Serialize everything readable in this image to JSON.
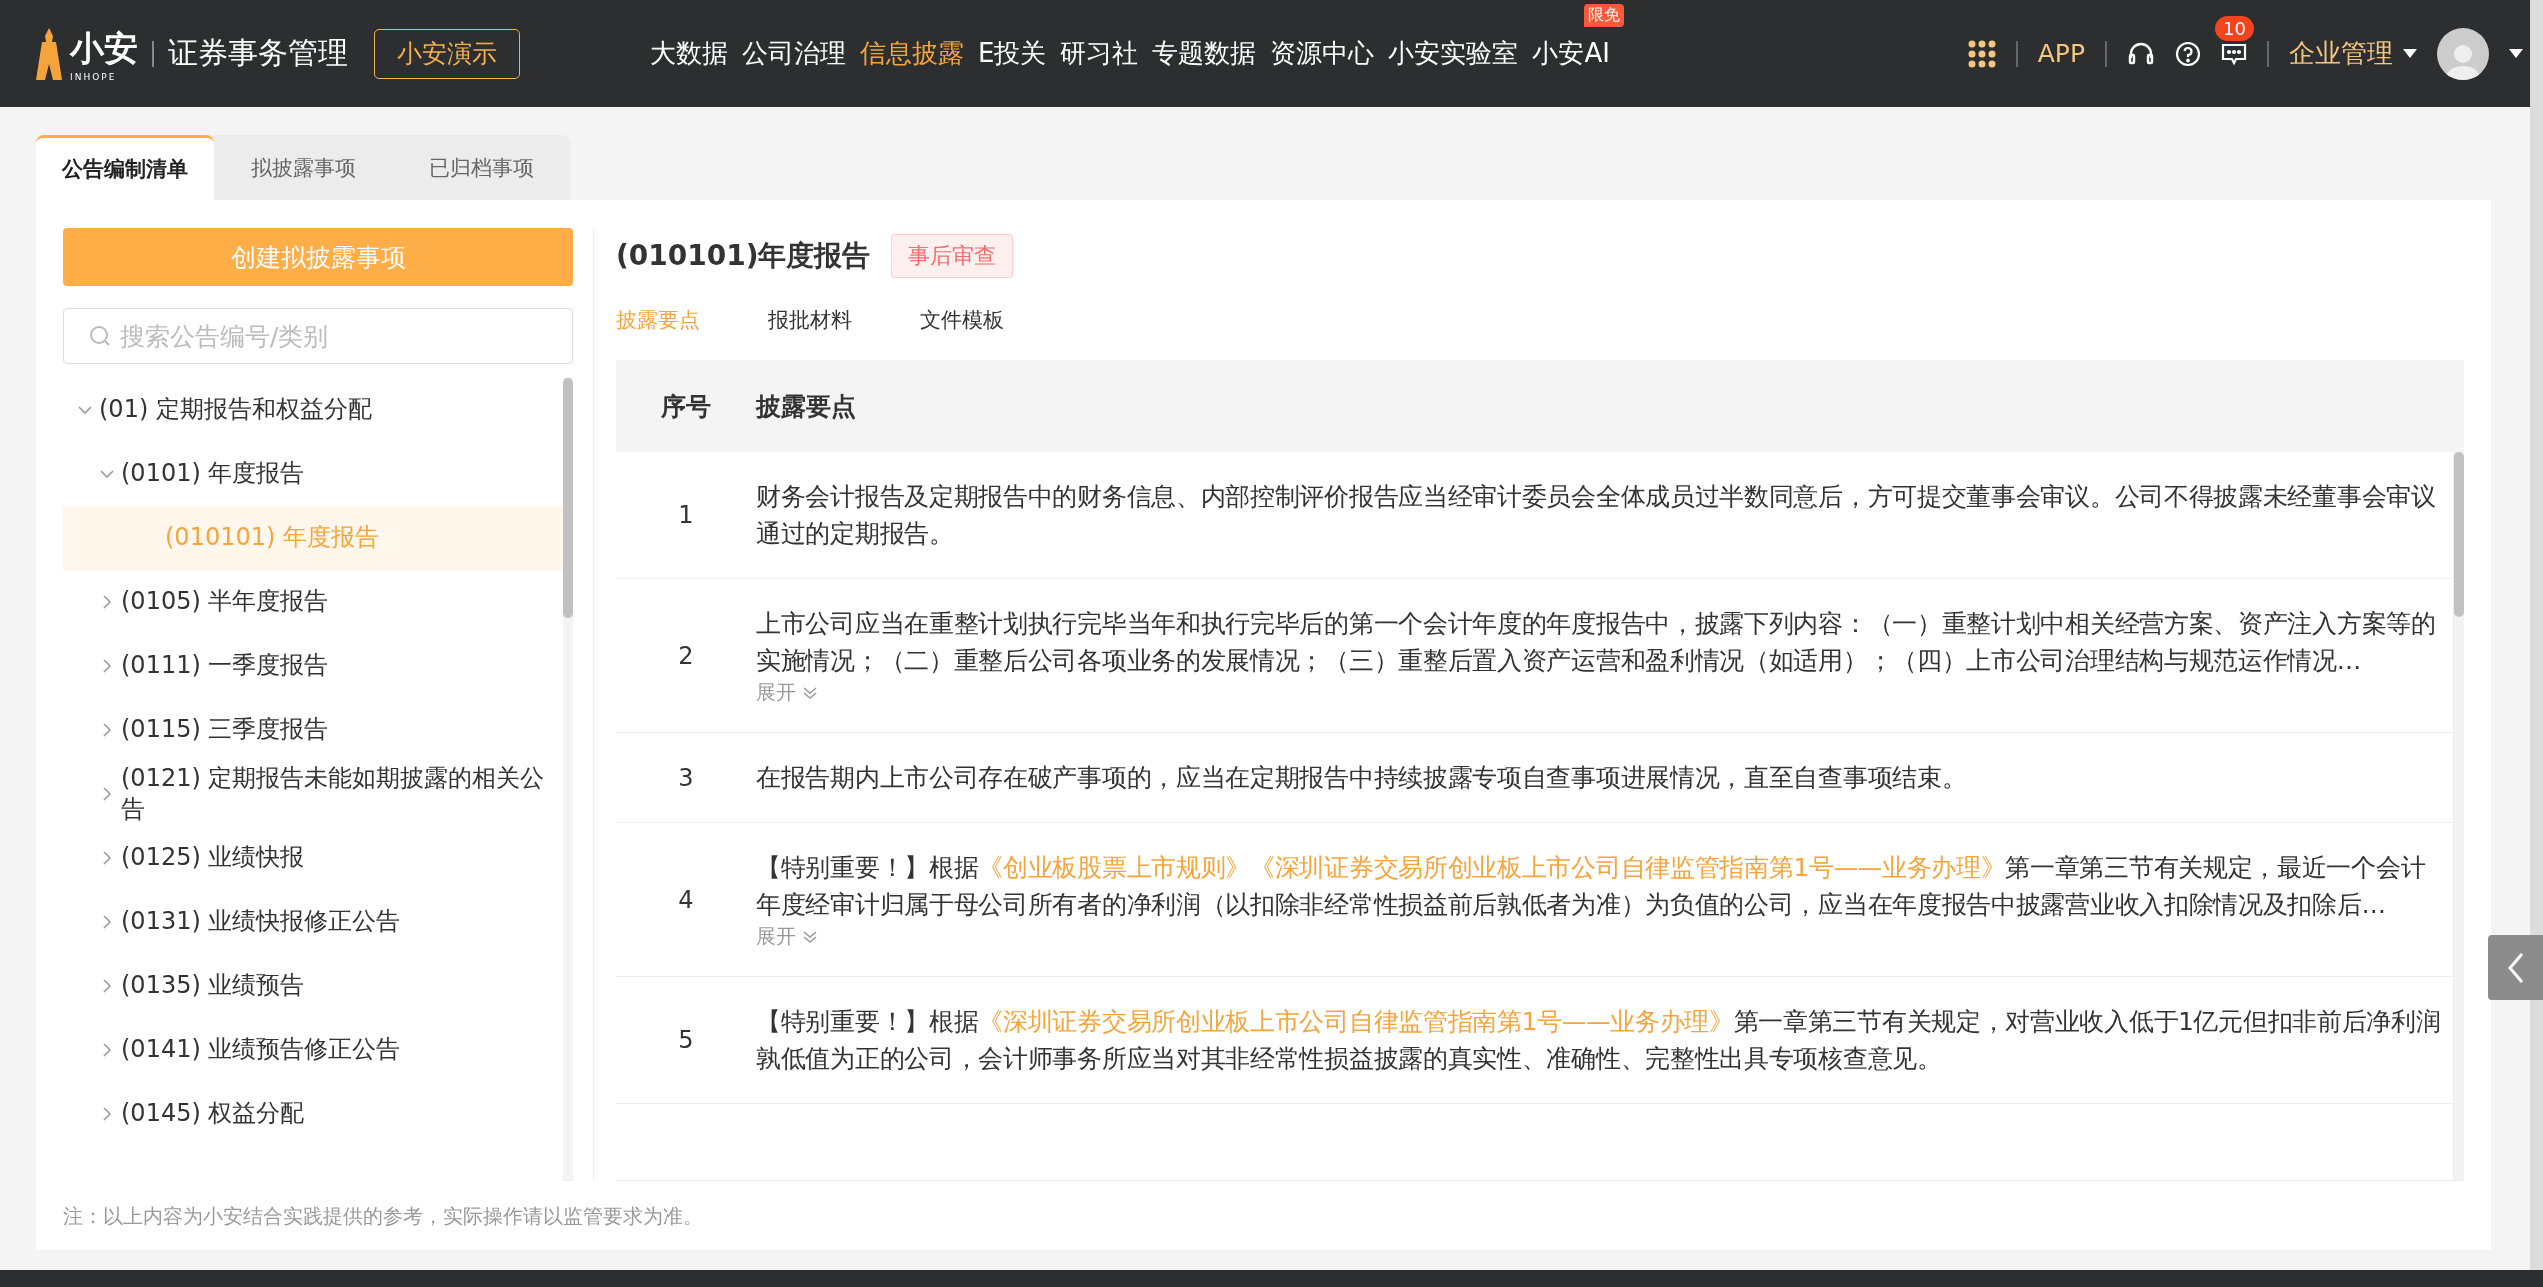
{
  "header": {
    "logo_text": "小安",
    "logo_sub": "INHOPE",
    "title": "证券事务管理",
    "demo_button": "小安演示",
    "nav": [
      {
        "label": "大数据",
        "selected": false
      },
      {
        "label": "公司治理",
        "selected": false
      },
      {
        "label": "信息披露",
        "selected": true
      },
      {
        "label": "E投关",
        "selected": false
      },
      {
        "label": "研习社",
        "selected": false
      },
      {
        "label": "专题数据",
        "selected": false
      },
      {
        "label": "资源中心",
        "selected": false
      },
      {
        "label": "小安实验室",
        "selected": false
      },
      {
        "label": "小安AI",
        "selected": false,
        "badge": "限免"
      }
    ],
    "app_link": "APP",
    "message_count": "10",
    "org_menu": "企业管理"
  },
  "tabs": [
    {
      "label": "公告编制清单",
      "selected": true
    },
    {
      "label": "拟披露事项",
      "selected": false
    },
    {
      "label": "已归档事项",
      "selected": false
    }
  ],
  "create_button": "创建拟披露事项",
  "search": {
    "placeholder": "搜索公告编号/类别"
  },
  "tree": [
    {
      "label": "(01) 定期报告和权益分配",
      "kind": "group",
      "expanded": true,
      "selected": false,
      "children": [
        {
          "label": "(0101) 年度报告",
          "kind": "group",
          "expanded": true,
          "selected": false,
          "children": [
            {
              "label": "(010101) 年度报告",
              "kind": "leaf",
              "expanded": false,
              "selected": true
            }
          ]
        },
        {
          "label": "(0105) 半年度报告",
          "kind": "group",
          "expanded": false,
          "selected": false
        },
        {
          "label": "(0111) 一季度报告",
          "kind": "group",
          "expanded": false,
          "selected": false
        },
        {
          "label": "(0115) 三季度报告",
          "kind": "group",
          "expanded": false,
          "selected": false
        },
        {
          "label": "(0121) 定期报告未能如期披露的相关公告",
          "kind": "group",
          "expanded": false,
          "selected": false
        },
        {
          "label": "(0125) 业绩快报",
          "kind": "group",
          "expanded": false,
          "selected": false
        },
        {
          "label": "(0131) 业绩快报修正公告",
          "kind": "group",
          "expanded": false,
          "selected": false
        },
        {
          "label": "(0135) 业绩预告",
          "kind": "group",
          "expanded": false,
          "selected": false
        },
        {
          "label": "(0141) 业绩预告修正公告",
          "kind": "group",
          "expanded": false,
          "selected": false
        },
        {
          "label": "(0145) 权益分配",
          "kind": "group",
          "expanded": false,
          "selected": false
        }
      ]
    }
  ],
  "detail": {
    "title": "(010101)年度报告",
    "tag": "事后审查",
    "subtabs": [
      {
        "label": "披露要点",
        "selected": true
      },
      {
        "label": "报批材料",
        "selected": false
      },
      {
        "label": "文件模板",
        "selected": false
      }
    ],
    "table": {
      "columns": [
        "序号",
        "披露要点"
      ],
      "rows": [
        {
          "number": "1",
          "parts": [
            {
              "kind": "text",
              "text": "财务会计报告及定期报告中的财务信息、内部控制评价报告应当经审计委员会全体成员过半数同意后，方可提交董事会审议。公司不得披露未经董事会审议通过的定期报告。"
            }
          ]
        },
        {
          "number": "2",
          "parts": [
            {
              "kind": "text",
              "text": "上市公司应当在重整计划执行完毕当年和执行完毕后的第一个会计年度的年度报告中，披露下列内容：（一）重整计划中相关经营方案、资产注入方案等的实施情况；（二）重整后公司各项业务的发展情况；（三）重整后置入资产运营和盈利情况（如适用）；（四）上市公司治理结构与规范运作情况…"
            }
          ],
          "expand": "展开"
        },
        {
          "number": "3",
          "parts": [
            {
              "kind": "text",
              "text": "在报告期内上市公司存在破产事项的，应当在定期报告中持续披露专项自查事项进展情况，直至自查事项结束。"
            }
          ]
        },
        {
          "number": "4",
          "parts": [
            {
              "kind": "text",
              "text": "【特别重要！】根据"
            },
            {
              "kind": "link",
              "text": "《创业板股票上市规则》"
            },
            {
              "kind": "link",
              "text": "《深圳证券交易所创业板上市公司自律监管指南第1号——业务办理》"
            },
            {
              "kind": "text",
              "text": "第一章第三节有关规定，最近一个会计年度经审计归属于母公司所有者的净利润（以扣除非经常性损益前后孰低者为准）为负值的公司，应当在年度报告中披露营业收入扣除情况及扣除后…"
            }
          ],
          "expand": "展开"
        },
        {
          "number": "5",
          "parts": [
            {
              "kind": "text",
              "text": "【特别重要！】根据"
            },
            {
              "kind": "link",
              "text": "《深圳证券交易所创业板上市公司自律监管指南第1号——业务办理》"
            },
            {
              "kind": "text",
              "text": "第一章第三节有关规定，对营业收入低于1亿元但扣非前后净利润孰低值为正的公司，会计师事务所应当对其非经常性损益披露的真实性、准确性、完整性出具专项核查意见。"
            }
          ]
        }
      ]
    }
  },
  "footnote": "注：以上内容为小安结合实践提供的参考，实际操作请以监管要求为准。"
}
